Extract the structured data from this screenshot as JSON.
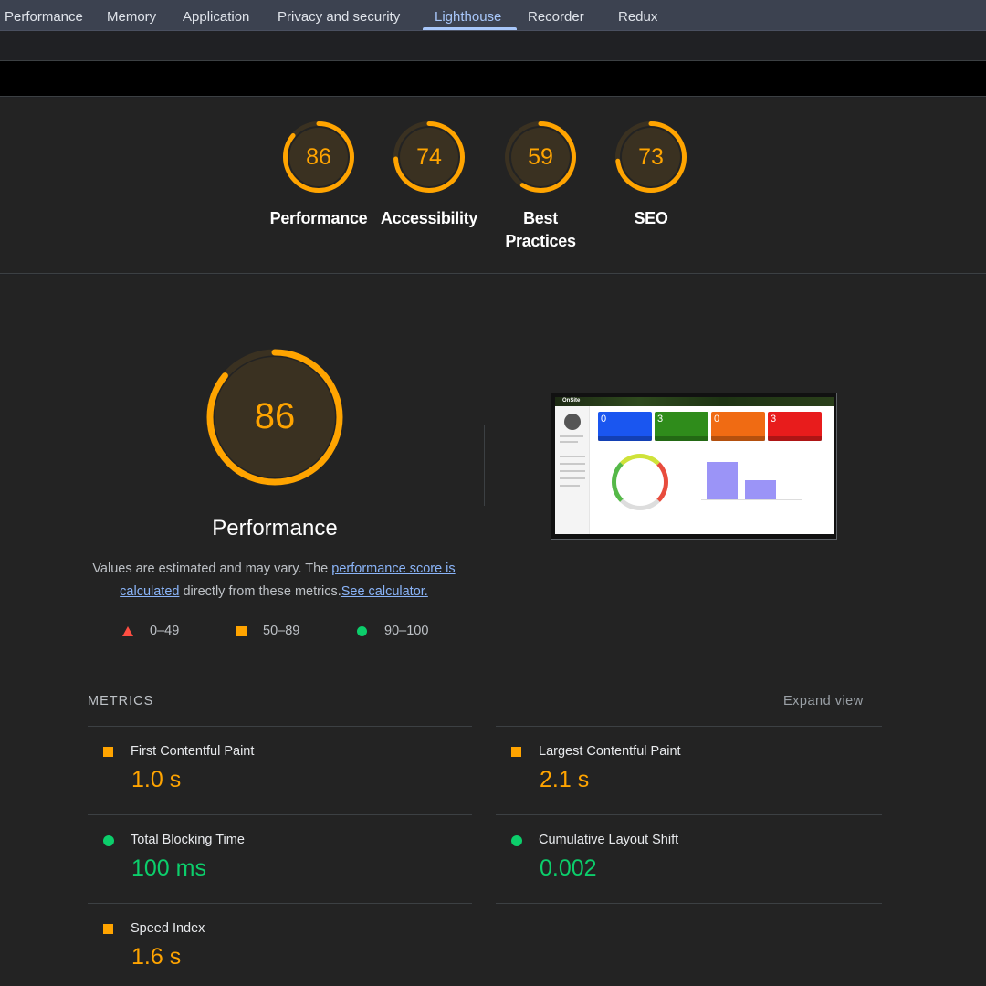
{
  "tabs": [
    {
      "label": "Performance",
      "active": false
    },
    {
      "label": "Memory",
      "active": false
    },
    {
      "label": "Application",
      "active": false
    },
    {
      "label": "Privacy and security",
      "active": false
    },
    {
      "label": "Lighthouse",
      "active": true
    },
    {
      "label": "Recorder",
      "active": false
    },
    {
      "label": "Redux",
      "active": false
    }
  ],
  "categories": [
    {
      "score": "86",
      "label": "Performance",
      "fraction": 0.86
    },
    {
      "score": "74",
      "label": "Accessibility",
      "fraction": 0.74
    },
    {
      "score": "59",
      "label_line1": "Best",
      "label_line2": "Practices",
      "fraction": 0.59
    },
    {
      "score": "73",
      "label": "SEO",
      "fraction": 0.73
    }
  ],
  "performance": {
    "score": "86",
    "fraction": 0.86,
    "title": "Performance",
    "desc_prefix": "Values are estimated and may vary. The ",
    "desc_link1_a": "performance score is",
    "desc_link1_b": "calculated",
    "desc_middle": " directly from these metrics.",
    "desc_link2": "See calculator.",
    "legend": {
      "fail": "0–49",
      "average": "50–89",
      "pass": "90–100"
    }
  },
  "screenshot_thumb": {
    "brand": "OnSite",
    "cards": [
      {
        "value": "0",
        "color": "#1a56f0"
      },
      {
        "value": "3",
        "color": "#2f8c1b"
      },
      {
        "value": "0",
        "color": "#f06b13"
      },
      {
        "value": "3",
        "color": "#e81c1c"
      }
    ]
  },
  "metrics": {
    "heading": "METRICS",
    "expand_label": "Expand view",
    "items": [
      {
        "name": "First Contentful Paint",
        "value": "1.0 s",
        "rating": "average"
      },
      {
        "name": "Largest Contentful Paint",
        "value": "2.1 s",
        "rating": "average"
      },
      {
        "name": "Total Blocking Time",
        "value": "100 ms",
        "rating": "pass"
      },
      {
        "name": "Cumulative Layout Shift",
        "value": "0.002",
        "rating": "pass"
      },
      {
        "name": "Speed Index",
        "value": "1.6 s",
        "rating": "average"
      }
    ]
  },
  "colors": {
    "average": "#ffa400",
    "pass": "#0cce6b",
    "fail": "#ff4e42",
    "link": "#8ab4f8",
    "active_tab": "#a8c7fa"
  }
}
